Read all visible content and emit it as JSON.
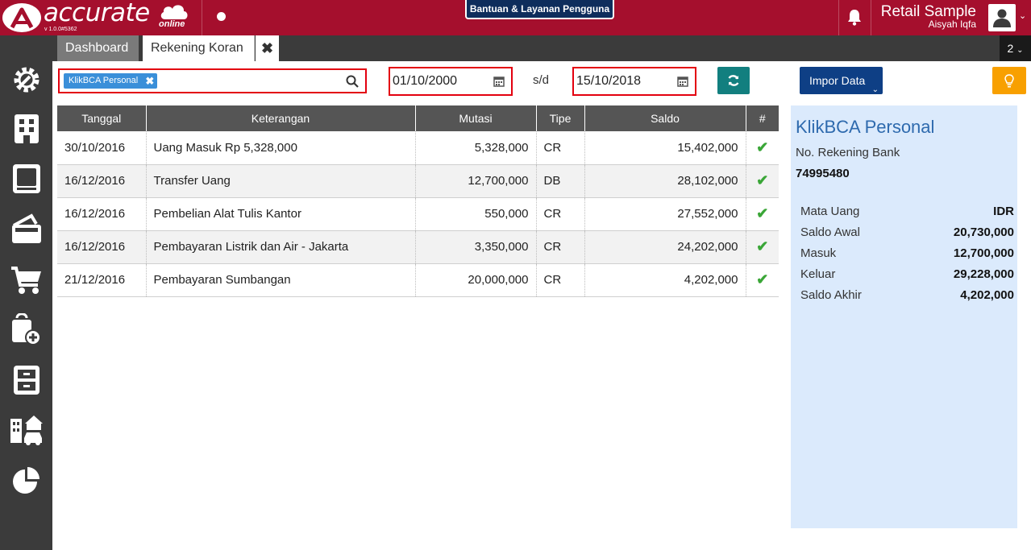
{
  "app": {
    "logo_text": "accurate",
    "logo_sub": "online",
    "version": "v 1.0.0#5362",
    "help_label": "Bantuan & Layanan Pengguna",
    "user_title": "Retail Sample",
    "user_name": "Aisyah Iqfa"
  },
  "tabs": [
    {
      "label": "Dashboard"
    },
    {
      "label": "Rekening Koran"
    }
  ],
  "tab_count": "2",
  "sidebar": {
    "icons": [
      "gear-icon",
      "building-icon",
      "ledger-book-icon",
      "wallet-icon",
      "cart-icon",
      "shopping-bag-add-icon",
      "cabinet-icon",
      "property-car-icon",
      "pie-chart-icon"
    ]
  },
  "filter": {
    "account_chip": "KlikBCA Personal",
    "date_from": "01/10/2000",
    "date_separator": "s/d",
    "date_to": "15/10/2018",
    "import_label": "Impor Data"
  },
  "table": {
    "headers": [
      "Tanggal",
      "Keterangan",
      "Mutasi",
      "Tipe",
      "Saldo",
      "#"
    ],
    "rows": [
      {
        "tanggal": "30/10/2016",
        "keterangan": "Uang Masuk Rp 5,328,000",
        "mutasi": "5,328,000",
        "tipe": "CR",
        "saldo": "15,402,000"
      },
      {
        "tanggal": "16/12/2016",
        "keterangan": "Transfer Uang",
        "mutasi": "12,700,000",
        "tipe": "DB",
        "saldo": "28,102,000"
      },
      {
        "tanggal": "16/12/2016",
        "keterangan": "Pembelian Alat Tulis Kantor",
        "mutasi": "550,000",
        "tipe": "CR",
        "saldo": "27,552,000"
      },
      {
        "tanggal": "16/12/2016",
        "keterangan": "Pembayaran Listrik dan Air - Jakarta",
        "mutasi": "3,350,000",
        "tipe": "CR",
        "saldo": "24,202,000"
      },
      {
        "tanggal": "21/12/2016",
        "keterangan": "Pembayaran Sumbangan",
        "mutasi": "20,000,000",
        "tipe": "CR",
        "saldo": "4,202,000"
      }
    ]
  },
  "panel": {
    "title": "KlikBCA Personal",
    "account_label": "No. Rekening Bank",
    "account_number": "74995480",
    "summary": [
      {
        "label": "Mata Uang",
        "value": "IDR"
      },
      {
        "label": "Saldo Awal",
        "value": "20,730,000"
      },
      {
        "label": "Masuk",
        "value": "12,700,000"
      },
      {
        "label": "Keluar",
        "value": "29,228,000"
      },
      {
        "label": "Saldo Akhir",
        "value": "4,202,000"
      }
    ]
  },
  "colors": {
    "brand": "#a50f2d",
    "accent_blue": "#0e3f85",
    "teal": "#127f7f",
    "warning": "#f8a000",
    "panel_bg": "#dbeafc",
    "check": "#3aa637"
  }
}
